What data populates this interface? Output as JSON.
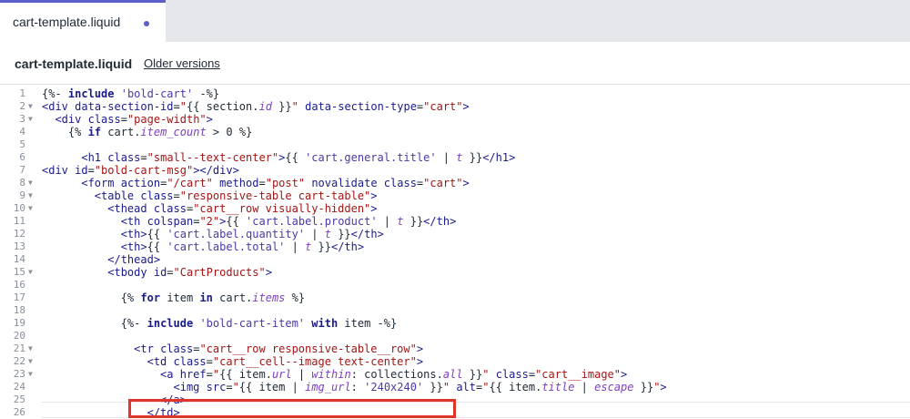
{
  "tab": {
    "label": "cart-template.liquid"
  },
  "header": {
    "title": "cart-template.liquid",
    "older_versions": "Older versions"
  },
  "lines": [
    {
      "n": "1",
      "fold": false,
      "text": "{%- include 'bold-cart' -%}"
    },
    {
      "n": "2",
      "fold": true,
      "text": "<div data-section-id=\"{{ section.id }}\" data-section-type=\"cart\">"
    },
    {
      "n": "3",
      "fold": true,
      "text": "  <div class=\"page-width\">"
    },
    {
      "n": "4",
      "fold": false,
      "text": "    {% if cart.item_count > 0 %}"
    },
    {
      "n": "5",
      "fold": false,
      "text": ""
    },
    {
      "n": "6",
      "fold": false,
      "text": "      <h1 class=\"small--text-center\">{{ 'cart.general.title' | t }}</h1>"
    },
    {
      "n": "7",
      "fold": false,
      "text": "<div id=\"bold-cart-msg\"></div>"
    },
    {
      "n": "8",
      "fold": true,
      "text": "      <form action=\"/cart\" method=\"post\" novalidate class=\"cart\">"
    },
    {
      "n": "9",
      "fold": true,
      "text": "        <table class=\"responsive-table cart-table\">"
    },
    {
      "n": "10",
      "fold": true,
      "text": "          <thead class=\"cart__row visually-hidden\">"
    },
    {
      "n": "11",
      "fold": false,
      "text": "            <th colspan=\"2\">{{ 'cart.label.product' | t }}</th>"
    },
    {
      "n": "12",
      "fold": false,
      "text": "            <th>{{ 'cart.label.quantity' | t }}</th>"
    },
    {
      "n": "13",
      "fold": false,
      "text": "            <th>{{ 'cart.label.total' | t }}</th>"
    },
    {
      "n": "14",
      "fold": false,
      "text": "          </thead>"
    },
    {
      "n": "15",
      "fold": true,
      "text": "          <tbody id=\"CartProducts\">"
    },
    {
      "n": "16",
      "fold": false,
      "text": ""
    },
    {
      "n": "17",
      "fold": false,
      "text": "            {% for item in cart.items %}"
    },
    {
      "n": "18",
      "fold": false,
      "text": ""
    },
    {
      "n": "19",
      "fold": false,
      "text": "            {%- include 'bold-cart-item' with item -%}"
    },
    {
      "n": "20",
      "fold": false,
      "text": ""
    },
    {
      "n": "21",
      "fold": true,
      "text": "              <tr class=\"cart__row responsive-table__row\">"
    },
    {
      "n": "22",
      "fold": true,
      "text": "                <td class=\"cart__cell--image text-center\">"
    },
    {
      "n": "23",
      "fold": true,
      "text": "                  <a href=\"{{ item.url | within: collections.all }}\" class=\"cart__image\">"
    },
    {
      "n": "24",
      "fold": false,
      "text": "                    <img src=\"{{ item | img_url: '240x240' }}\" alt=\"{{ item.title | escape }}\">"
    },
    {
      "n": "25",
      "fold": false,
      "text": "                  </a>"
    },
    {
      "n": "26",
      "fold": false,
      "text": "                </td>"
    }
  ]
}
